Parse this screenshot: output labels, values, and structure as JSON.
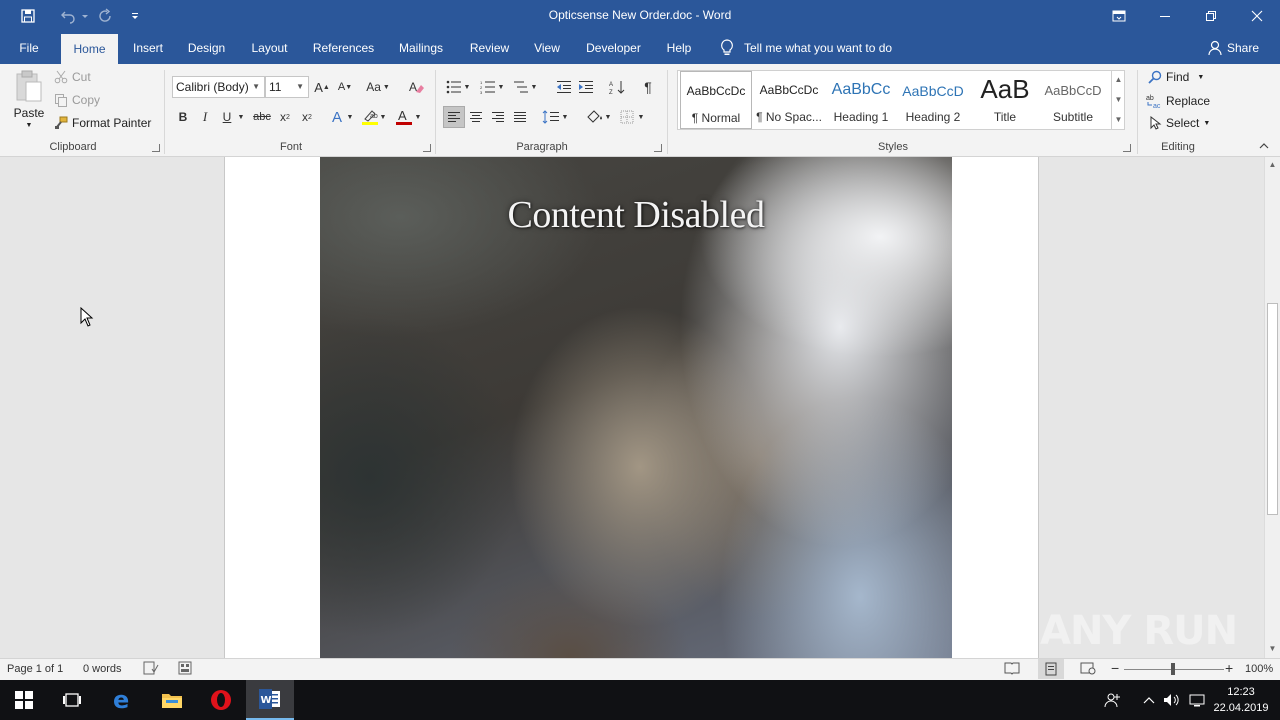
{
  "window": {
    "title": "Opticsense New Order.doc  -  Word",
    "controls": [
      "ribbon-options-icon",
      "minimize-icon",
      "restore-icon",
      "close-icon"
    ]
  },
  "tabs": [
    {
      "label": "File",
      "active": false
    },
    {
      "label": "Home",
      "active": true
    },
    {
      "label": "Insert",
      "active": false
    },
    {
      "label": "Design",
      "active": false
    },
    {
      "label": "Layout",
      "active": false
    },
    {
      "label": "References",
      "active": false
    },
    {
      "label": "Mailings",
      "active": false
    },
    {
      "label": "Review",
      "active": false
    },
    {
      "label": "View",
      "active": false
    },
    {
      "label": "Developer",
      "active": false
    },
    {
      "label": "Help",
      "active": false
    }
  ],
  "tellme": {
    "placeholder": "Tell me what you want to do"
  },
  "share_label": "Share",
  "clipboard": {
    "paste": "Paste",
    "cut": "Cut",
    "copy": "Copy",
    "format_painter": "Format Painter",
    "group": "Clipboard"
  },
  "font": {
    "family": "Calibri (Body)",
    "size": "11",
    "change_case": "Aa",
    "group": "Font",
    "font_color": "#c00000",
    "highlight_color": "#ffff00"
  },
  "paragraph": {
    "group": "Paragraph",
    "pilcrow": "¶"
  },
  "styles": {
    "group": "Styles",
    "items": [
      {
        "sample": "AaBbCcDc",
        "name": "¶ Normal",
        "selected": true
      },
      {
        "sample": "AaBbCcDc",
        "name": "¶ No Spac...",
        "selected": false
      },
      {
        "sample": "AaBbCc",
        "name": "Heading 1",
        "selected": false
      },
      {
        "sample": "AaBbCcD",
        "name": "Heading 2",
        "selected": false
      },
      {
        "sample": "AaB",
        "name": "Title",
        "selected": false
      },
      {
        "sample": "AaBbCcD",
        "name": "Subtitle",
        "selected": false
      }
    ]
  },
  "editing": {
    "find": "Find",
    "replace": "Replace",
    "select": "Select",
    "group": "Editing"
  },
  "document": {
    "image_caption": "Content Disabled"
  },
  "status": {
    "page": "Page 1 of 1",
    "words": "0 words",
    "zoom": "100%",
    "zoom_level": 100
  },
  "watermark": "ANY RUN",
  "taskbar": {
    "time": "12:23",
    "date": "22.04.2019"
  },
  "colors": {
    "accent": "#2b579a",
    "ribbon_bg": "#f3f3f3",
    "taskbar_bg": "#101114"
  }
}
